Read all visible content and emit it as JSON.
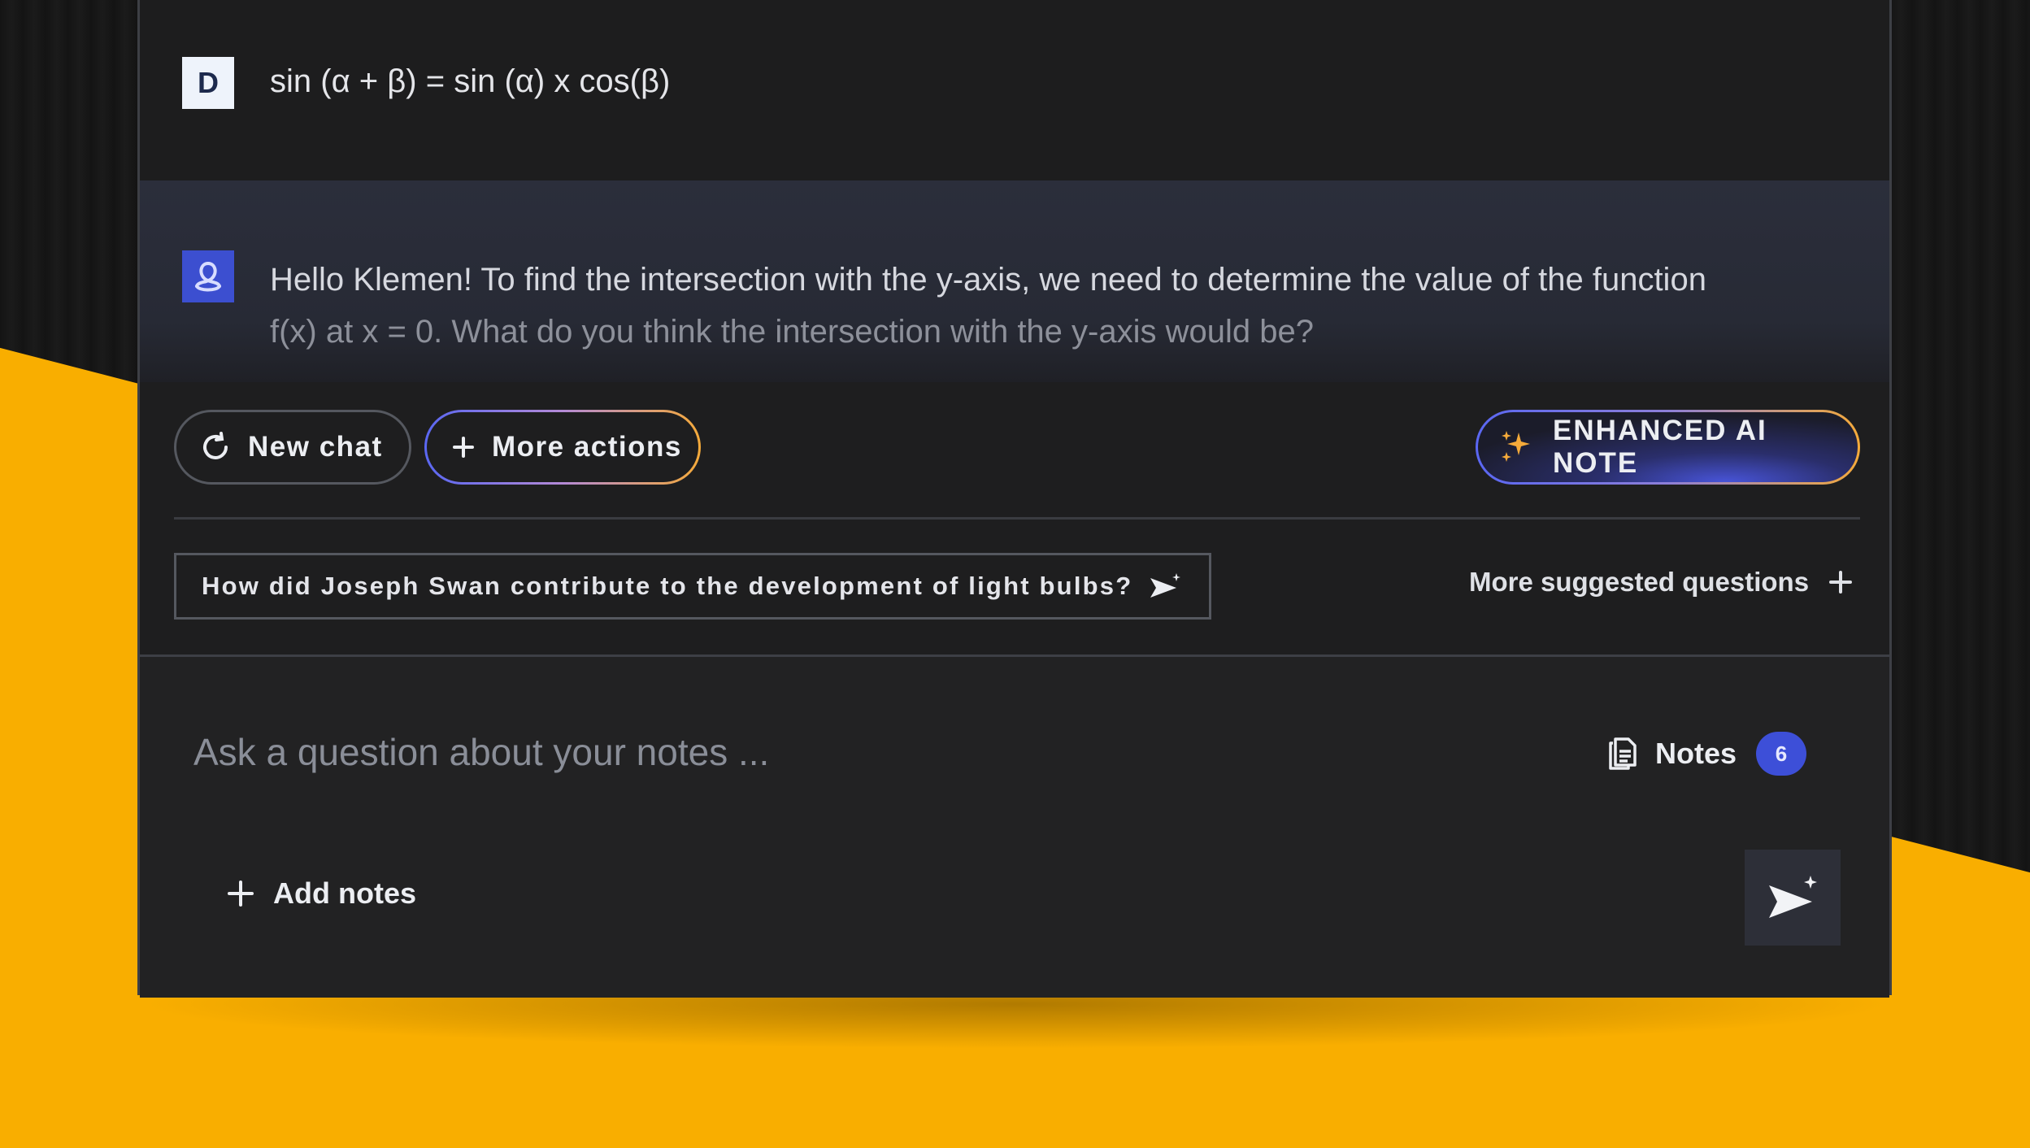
{
  "chat": {
    "user_avatar_letter": "D",
    "user_message": "sin (α + β) = sin (α) x cos(β)",
    "ai_message_line1": "Hello Klemen! To find the intersection with the y-axis, we need to determine the value of the function",
    "ai_message_line2": "f(x) at x = 0. What do you think the intersection with the y-axis would be?"
  },
  "actions": {
    "new_chat": "New chat",
    "more_actions": "More actions",
    "enhanced_note": "ENHANCED AI NOTE"
  },
  "suggestions": {
    "question": "How did Joseph Swan contribute to the development of light bulbs?",
    "more": "More suggested questions"
  },
  "composer": {
    "placeholder": "Ask a question about your notes ...",
    "notes_label": "Notes",
    "notes_count": "6",
    "add_notes": "Add notes"
  },
  "colors": {
    "background_yellow": "#f9ae00",
    "accent_blue": "#3d4fd8",
    "accent_orange": "#f5aa3a"
  },
  "icons": [
    "refresh-icon",
    "plus-icon",
    "sparkles-icon",
    "send-sparkle-icon",
    "document-copy-icon",
    "ai-knot-icon"
  ]
}
